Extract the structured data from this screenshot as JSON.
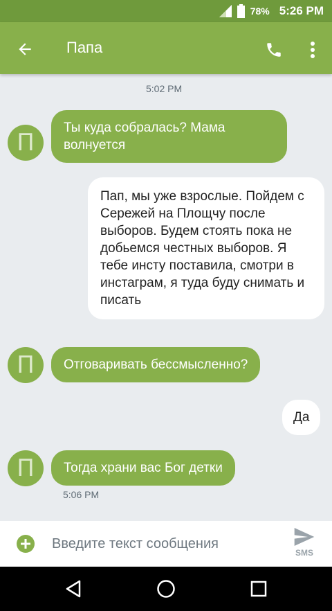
{
  "status_bar": {
    "battery": "78%",
    "time": "5:26 PM"
  },
  "header": {
    "contact_name": "Папа",
    "back_icon": "arrow-left-icon",
    "call_icon": "phone-icon",
    "menu_icon": "more-vert-icon"
  },
  "messages": [
    {
      "type": "timestamp",
      "text": "5:02 PM"
    },
    {
      "direction": "incoming",
      "avatar": "П",
      "text": "Ты куда собралась? Мама волнуется"
    },
    {
      "direction": "outgoing",
      "text": "Пап, мы уже взрослые. Пойдем с Сережей на Площчу после выборов. Будем стоять пока не добьемся честных выборов. Я тебе инсту поставила, смотри в инстаграм, я туда буду снимать и писать"
    },
    {
      "direction": "incoming",
      "avatar": "П",
      "text": "Отговаривать бессмысленно?"
    },
    {
      "direction": "outgoing",
      "text": "Да"
    },
    {
      "direction": "incoming",
      "avatar": "П",
      "text": "Тогда храни вас Бог детки"
    },
    {
      "type": "timestamp",
      "text": "5:06 PM"
    }
  ],
  "composer": {
    "placeholder": "Введите текст сообщения",
    "send_label": "SMS"
  },
  "colors": {
    "accent": "#88b04b",
    "status_bar": "#6f9a3c",
    "background": "#e9ecef"
  }
}
